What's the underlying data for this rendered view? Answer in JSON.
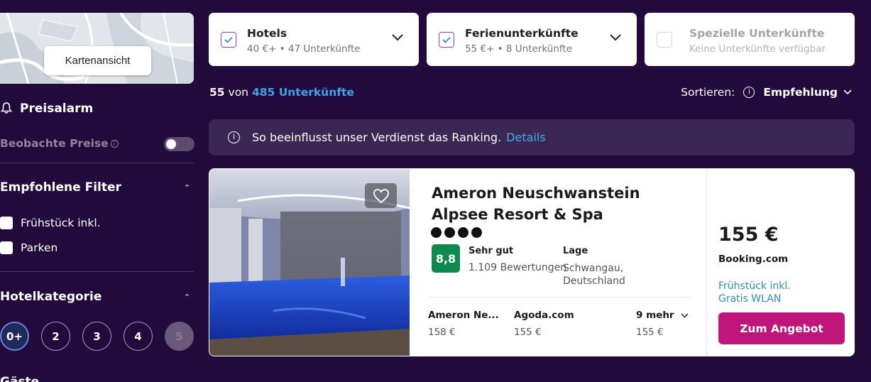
{
  "map": {
    "button_label": "Kartenansicht"
  },
  "sidebar": {
    "price_alarm": {
      "title": "Preisalarm",
      "watch_label": "Beobachte Preise",
      "watch_info": "i"
    },
    "recommended_filters": {
      "title": "Empfohlene Filter",
      "items": [
        {
          "label": "Frühstück inkl."
        },
        {
          "label": "Parken"
        }
      ]
    },
    "hotel_category": {
      "title": "Hotelkategorie",
      "options": [
        "0+",
        "2",
        "3",
        "4",
        "5"
      ],
      "selected": "0+",
      "disabled": "5"
    },
    "next_section_title": "Gäste"
  },
  "accommodation_types": [
    {
      "name": "Hotels",
      "detail": "40 €+ • 47 Unterkünfte",
      "checked": true
    },
    {
      "name": "Ferienunterkünfte",
      "detail": "55 €+ • 8 Unterkünfte",
      "checked": true
    },
    {
      "name": "Spezielle Unterkünfte",
      "detail": "Keine Unterkünfte verfügbar",
      "checked": false
    }
  ],
  "results": {
    "shown": "55",
    "of": "von",
    "total_label": "485 Unterkünfte"
  },
  "sort": {
    "label": "Sortieren:",
    "info": "i",
    "value": "Empfehlung"
  },
  "ranking_notice": {
    "text": "So beeinflusst unser Verdienst das Ranking.",
    "link": "Details",
    "info": "i"
  },
  "hotel": {
    "name": "Ameron Neuschwanstein Alpsee Resort & Spa",
    "stars": 4,
    "score": "8,8",
    "rating_label": "Sehr gut",
    "review_count": "1.109 Bewertungen",
    "location_label": "Lage",
    "location": "Schwangau, Deutschland",
    "offers": [
      {
        "name": "Ameron Ne...",
        "price": "158 €"
      },
      {
        "name": "Agoda.com",
        "price": "155 €"
      },
      {
        "name": "9 mehr",
        "price": "155 €"
      }
    ],
    "price": "155 €",
    "provider": "Booking.com",
    "perks": [
      "Frühstück inkl.",
      "Gratis WLAN"
    ],
    "cta": "Zum Angebot"
  },
  "colors": {
    "background": "#220a3c",
    "accent_link": "#3fa4e8",
    "cta": "#c0157a",
    "score": "#0f8a4e"
  },
  "icons": {
    "bell": "bell-icon",
    "heart": "heart-icon",
    "chevron": "chevron-down-icon",
    "check": "check-icon",
    "info": "info-icon"
  }
}
